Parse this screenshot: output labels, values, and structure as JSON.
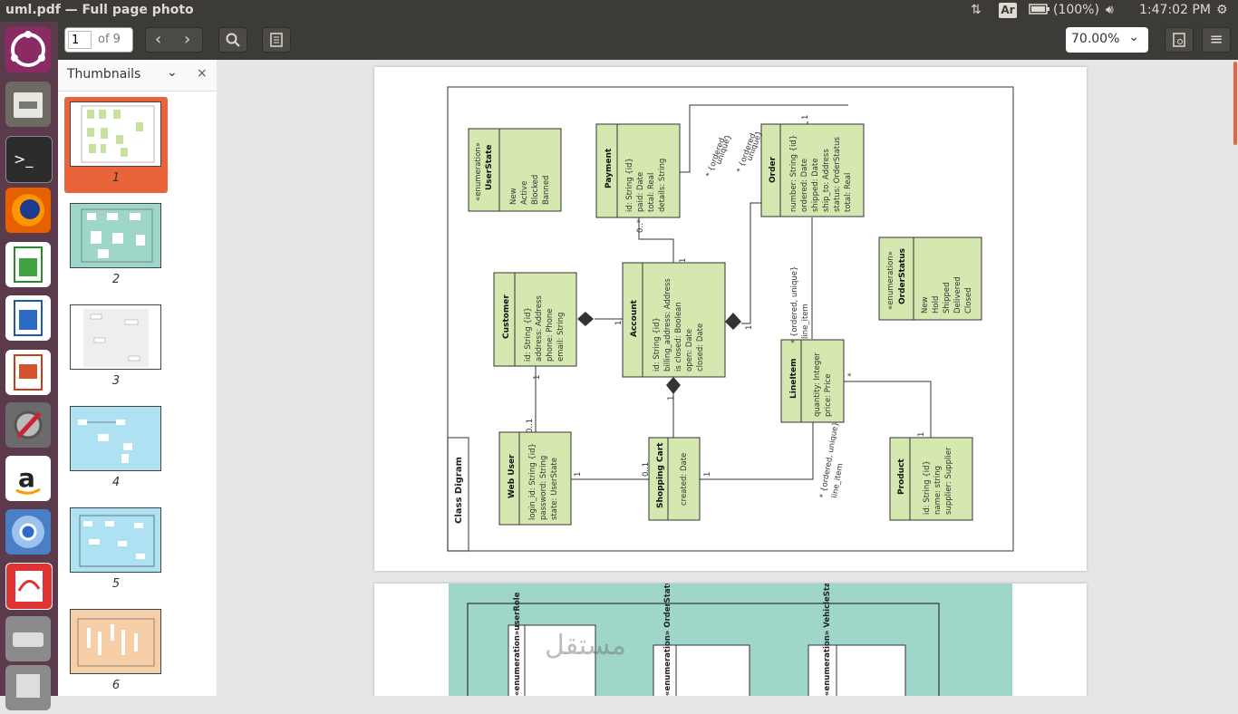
{
  "window": {
    "title": "uml.pdf — Full page photo"
  },
  "top_panel": {
    "keyboard_layout": "Ar",
    "battery": "(100%)",
    "clock": "1:47:02 PM",
    "icons": [
      "network-icon",
      "battery-icon",
      "volume-icon",
      "settings-icon"
    ]
  },
  "toolbar": {
    "page_input": "1",
    "page_total": "of 9",
    "zoom": "70.00%"
  },
  "sidebar": {
    "title": "Thumbnails",
    "pages": [
      "1",
      "2",
      "3",
      "4",
      "5",
      "6"
    ]
  },
  "launcher": {
    "apps": [
      "ubuntu-dash",
      "files",
      "terminal",
      "firefox",
      "libreoffice-calc",
      "libreoffice-writer",
      "libreoffice-impress",
      "system-settings",
      "amazon",
      "chromium",
      "document-viewer",
      "drive",
      "trash"
    ]
  },
  "diagram": {
    "frame_label": "Class Digram",
    "classes": [
      {
        "name": "«enumeration»",
        "title": "UserState",
        "attrs": [
          "New",
          "Active",
          "Blocked",
          "Banned"
        ]
      },
      {
        "title": "Payment",
        "attrs": [
          "id: String {id}",
          "paid: Date",
          "total: Real",
          "details: String"
        ]
      },
      {
        "title": "Order",
        "attrs": [
          "number: String {id}",
          "ordered: Date",
          "shipped: Date",
          "ship_to: Address",
          "status: OrderStatus",
          "total: Real"
        ]
      },
      {
        "name": "«enumeration»",
        "title": "OrderStatus",
        "attrs": [
          "New",
          "Hold",
          "Shipped",
          "Delivered",
          "Closed"
        ]
      },
      {
        "title": "Customer",
        "attrs": [
          "id: String {id}",
          "address: Address",
          "phone: Phone",
          "email: String"
        ]
      },
      {
        "title": "Account",
        "attrs": [
          "id: String {id}",
          "billing_address: Address",
          "is closed: Boolean",
          "open: Date",
          "closed: Date"
        ]
      },
      {
        "title": "LineItem",
        "attrs": [
          "quantity: Integer",
          "price: Price"
        ]
      },
      {
        "title": "Web User",
        "attrs": [
          "login_id: String {id}",
          "password: String",
          "state: UserState"
        ]
      },
      {
        "title": "Shopping Cart",
        "attrs": [
          "created: Date"
        ]
      },
      {
        "title": "Product",
        "attrs": [
          "id: String {id}",
          "name: string",
          "supplier: Supplier"
        ]
      }
    ],
    "labels": {
      "ord_unique_1a": "* {ordered,",
      "ord_unique_1b": "unique}",
      "ord_unique_2a": "* {ordered,",
      "ord_unique_2b": "unique}",
      "ord_unique_3": "* {ordered, unique}",
      "line_item": "line_item",
      "ord_unique_4": "* {ordered, unique}",
      "line_item_2": "line_item",
      "one": "1",
      "zero_star": "0..*",
      "zero_one": "0..1",
      "star": "*"
    }
  },
  "page2": {
    "labels": [
      "«enumeration»userRole",
      "«enumeration» OrderStatus",
      "«enumeration» VehicleStatus"
    ],
    "watermark": "مستقل"
  },
  "colors": {
    "class_fill": "#d4e8b0",
    "thumb_selected": "#e9643a",
    "page2_bg": "#9ed7ca"
  }
}
